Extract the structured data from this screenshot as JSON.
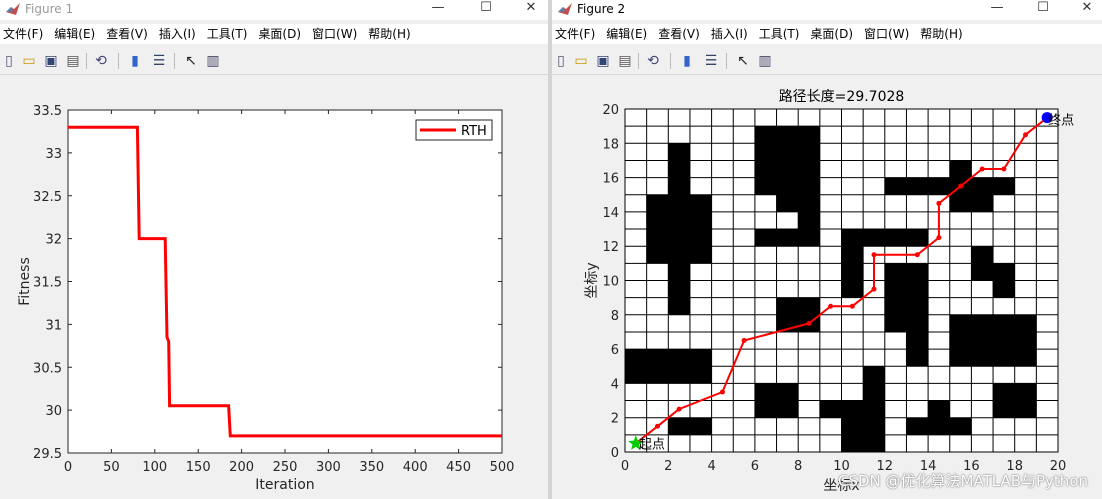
{
  "windows": [
    {
      "title": "Figure 1",
      "menus": [
        "文件(F)",
        "编辑(E)",
        "查看(V)",
        "插入(I)",
        "工具(T)",
        "桌面(D)",
        "窗口(W)",
        "帮助(H)"
      ]
    },
    {
      "title": "Figure 2",
      "menus": [
        "文件(F)",
        "编辑(E)",
        "查看(V)",
        "插入(I)",
        "工具(T)",
        "桌面(D)",
        "窗口(W)",
        "帮助(H)"
      ]
    }
  ],
  "window_controls": {
    "minimize": "—",
    "maximize": "☐",
    "close": "✕"
  },
  "toolbar_icons": [
    "new-figure-icon",
    "open-file-icon",
    "save-icon",
    "print-icon",
    "link-plot-icon",
    "colorbar-icon",
    "legend-icon",
    "pointer-icon",
    "property-inspector-icon"
  ],
  "colors": {
    "curve": "#ff0000",
    "obstacle": "#000000",
    "start": "#00cc00",
    "goal": "#0000ff",
    "path": "#ff0000"
  },
  "watermark": "CSDN @优化算法MATLAB与Python",
  "chart_data": [
    {
      "type": "line",
      "title": "",
      "xlabel": "Iteration",
      "ylabel": "Fitness",
      "xlim": [
        0,
        500
      ],
      "ylim": [
        29.5,
        33.5
      ],
      "xticks": [
        0,
        50,
        100,
        150,
        200,
        250,
        300,
        350,
        400,
        450,
        500
      ],
      "yticks": [
        29.5,
        30,
        30.5,
        31,
        31.5,
        32,
        32.5,
        33,
        33.5
      ],
      "legend": "top-right",
      "series": [
        {
          "name": "RTH",
          "points": [
            [
              0,
              33.3
            ],
            [
              80,
              33.3
            ],
            [
              82,
              32.0
            ],
            [
              112,
              32.0
            ],
            [
              114,
              30.85
            ],
            [
              116,
              30.8
            ],
            [
              117,
              30.05
            ],
            [
              185,
              30.05
            ],
            [
              187,
              29.7
            ],
            [
              500,
              29.7
            ]
          ]
        }
      ]
    },
    {
      "type": "line",
      "title": "路径长度=29.7028",
      "xlabel": "坐标x",
      "ylabel": "坐标y",
      "xlim": [
        0,
        20
      ],
      "ylim": [
        0,
        20
      ],
      "xticks": [
        0,
        2,
        4,
        6,
        8,
        10,
        12,
        14,
        16,
        18,
        20
      ],
      "yticks": [
        0,
        2,
        4,
        6,
        8,
        10,
        12,
        14,
        16,
        18,
        20
      ],
      "grid": true,
      "start_label": "起点",
      "goal_label": "终点",
      "start": [
        0.5,
        0.5
      ],
      "goal": [
        19.5,
        19.5
      ],
      "obstacles": [
        [
          6,
          18
        ],
        [
          7,
          18
        ],
        [
          8,
          18
        ],
        [
          6,
          17
        ],
        [
          7,
          17
        ],
        [
          8,
          17
        ],
        [
          2,
          17
        ],
        [
          6,
          16
        ],
        [
          7,
          16
        ],
        [
          8,
          16
        ],
        [
          15,
          16
        ],
        [
          2,
          16
        ],
        [
          6,
          15
        ],
        [
          7,
          15
        ],
        [
          8,
          15
        ],
        [
          15,
          15
        ],
        [
          2,
          15
        ],
        [
          7,
          14
        ],
        [
          8,
          14
        ],
        [
          12,
          15
        ],
        [
          13,
          15
        ],
        [
          14,
          15
        ],
        [
          16,
          15
        ],
        [
          17,
          15
        ],
        [
          1,
          14
        ],
        [
          2,
          14
        ],
        [
          3,
          14
        ],
        [
          15,
          14
        ],
        [
          16,
          14
        ],
        [
          1,
          13
        ],
        [
          2,
          13
        ],
        [
          3,
          13
        ],
        [
          8,
          13
        ],
        [
          1,
          12
        ],
        [
          2,
          12
        ],
        [
          3,
          12
        ],
        [
          6,
          12
        ],
        [
          7,
          12
        ],
        [
          8,
          12
        ],
        [
          10,
          12
        ],
        [
          11,
          12
        ],
        [
          12,
          12
        ],
        [
          13,
          12
        ],
        [
          1,
          11
        ],
        [
          2,
          11
        ],
        [
          3,
          11
        ],
        [
          10,
          11
        ],
        [
          16,
          11
        ],
        [
          2,
          10
        ],
        [
          10,
          10
        ],
        [
          12,
          10
        ],
        [
          13,
          10
        ],
        [
          16,
          10
        ],
        [
          17,
          10
        ],
        [
          2,
          9
        ],
        [
          10,
          9
        ],
        [
          12,
          9
        ],
        [
          13,
          9
        ],
        [
          17,
          9
        ],
        [
          2,
          8
        ],
        [
          7,
          8
        ],
        [
          8,
          8
        ],
        [
          12,
          8
        ],
        [
          13,
          8
        ],
        [
          7,
          7
        ],
        [
          8,
          7
        ],
        [
          12,
          7
        ],
        [
          13,
          7
        ],
        [
          15,
          7
        ],
        [
          16,
          7
        ],
        [
          17,
          7
        ],
        [
          18,
          7
        ],
        [
          13,
          6
        ],
        [
          15,
          6
        ],
        [
          16,
          6
        ],
        [
          17,
          6
        ],
        [
          18,
          6
        ],
        [
          0,
          5
        ],
        [
          1,
          5
        ],
        [
          2,
          5
        ],
        [
          3,
          5
        ],
        [
          13,
          5
        ],
        [
          15,
          5
        ],
        [
          16,
          5
        ],
        [
          17,
          5
        ],
        [
          18,
          5
        ],
        [
          0,
          4
        ],
        [
          1,
          4
        ],
        [
          2,
          4
        ],
        [
          3,
          4
        ],
        [
          11,
          4
        ],
        [
          6,
          3
        ],
        [
          7,
          3
        ],
        [
          11,
          3
        ],
        [
          17,
          3
        ],
        [
          18,
          3
        ],
        [
          6,
          2
        ],
        [
          7,
          2
        ],
        [
          9,
          2
        ],
        [
          10,
          2
        ],
        [
          11,
          2
        ],
        [
          17,
          2
        ],
        [
          18,
          2
        ],
        [
          14,
          2
        ],
        [
          2,
          1
        ],
        [
          3,
          1
        ],
        [
          13,
          1
        ],
        [
          14,
          1
        ],
        [
          15,
          1
        ],
        [
          10,
          0
        ],
        [
          11,
          0
        ],
        [
          10,
          1
        ],
        [
          11,
          1
        ]
      ],
      "series": [
        {
          "points": [
            [
              0.5,
              0.5
            ],
            [
              1.5,
              1.5
            ],
            [
              2.5,
              2.5
            ],
            [
              4.5,
              3.5
            ],
            [
              5.5,
              6.5
            ],
            [
              8.5,
              7.5
            ],
            [
              9.5,
              8.5
            ],
            [
              10.5,
              8.5
            ],
            [
              11.5,
              9.5
            ],
            [
              11.5,
              11.5
            ],
            [
              13.5,
              11.5
            ],
            [
              14.5,
              12.5
            ],
            [
              14.5,
              14.5
            ],
            [
              15.5,
              15.5
            ],
            [
              16.5,
              16.5
            ],
            [
              17.5,
              16.5
            ],
            [
              18.5,
              18.5
            ],
            [
              19.5,
              19.5
            ]
          ]
        }
      ]
    }
  ]
}
